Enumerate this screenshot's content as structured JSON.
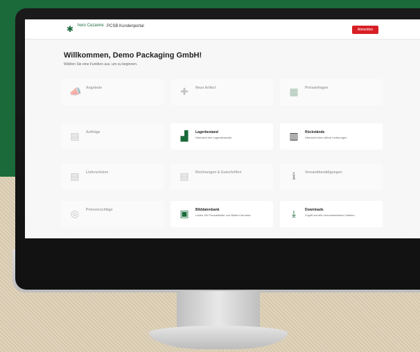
{
  "header": {
    "logo_text": "hero Cezanne",
    "portal_title": "PCSB Kundenportal",
    "logout_label": "Abmelden"
  },
  "welcome": {
    "title": "Willkommen, Demo Packaging GmbH!",
    "subtitle": "Wählen Sie eine Funktion aus, um zu beginnen."
  },
  "cards": [
    {
      "title": "Angebote",
      "desc": "",
      "icon": "megaphone-icon",
      "active": false
    },
    {
      "title": "Neue Artikel",
      "desc": "",
      "icon": "new-item-icon",
      "active": false
    },
    {
      "title": "Preisanfragen",
      "desc": "",
      "icon": "calculator-icon",
      "active": false
    },
    {
      "title": "Aufträge",
      "desc": "",
      "icon": "order-icon",
      "active": false
    },
    {
      "title": "Lagerbestand",
      "desc": "Übersicht des Lagerbestands",
      "icon": "stock-icon",
      "active": true
    },
    {
      "title": "Rückstände",
      "desc": "Übersicht über offene Lieferungen",
      "icon": "backlog-icon",
      "active": true
    },
    {
      "title": "Lieferscheine",
      "desc": "",
      "icon": "delivery-note-icon",
      "active": false
    },
    {
      "title": "Rechnungen & Gutschriften",
      "desc": "",
      "icon": "invoice-icon",
      "active": false
    },
    {
      "title": "Versandbestätigungen",
      "desc": "",
      "icon": "info-icon",
      "active": false
    },
    {
      "title": "Preisvorschläge",
      "desc": "",
      "icon": "price-icon",
      "active": false
    },
    {
      "title": "Bilddatenbank",
      "desc": "Laden Sie Produktbilder von Bildern herunter",
      "icon": "image-icon",
      "active": true
    },
    {
      "title": "Downloads",
      "desc": "Zugriff auf alle herunterladbaren Dateien",
      "icon": "download-icon",
      "active": true
    }
  ]
}
